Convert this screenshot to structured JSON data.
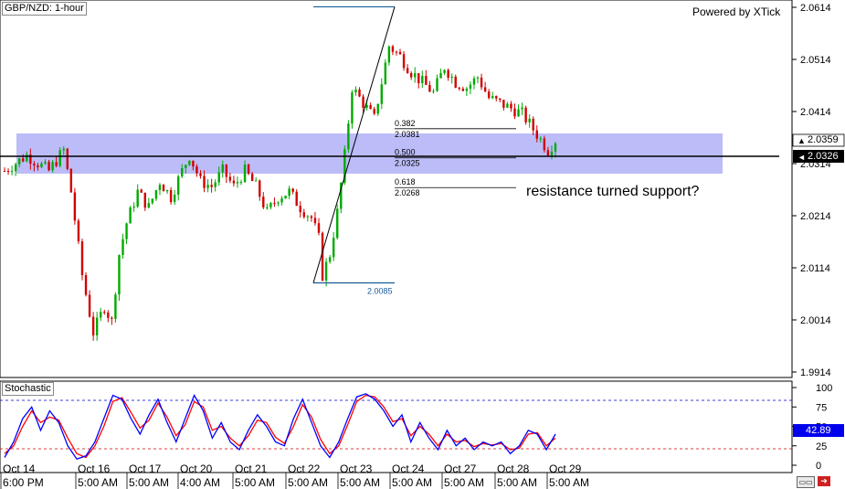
{
  "symbol_label": "GBP/NZD: 1-hour",
  "branding": "Powered by XTick",
  "annotation": "resistance turned support?",
  "indicator_label": "Stochastic",
  "icons": [
    "scroll-icon",
    "go-to-end-icon"
  ],
  "colors": {
    "bull_candle": "#00aa00",
    "bear_candle": "#d10000",
    "zone": "#8f8ff5",
    "stoch_k": "#0000ff",
    "stoch_d": "#ff0000",
    "level_80": "#0000cc",
    "level_20": "#cc0000"
  },
  "chart_data": [
    {
      "type": "candlestick",
      "title": "GBP/NZD: 1-hour",
      "y_ticks": [
        "2.0614",
        "2.0514",
        "2.0414",
        "2.0314",
        "2.0214",
        "2.0114",
        "2.0014",
        "1.9914"
      ],
      "x_ticks": [
        {
          "day": "Oct 14",
          "time": "6:00 PM"
        },
        {
          "day": "Oct 16",
          "time": "5:00 AM"
        },
        {
          "day": "Oct 17",
          "time": "5:00 AM"
        },
        {
          "day": "Oct 20",
          "time": "4:00 AM"
        },
        {
          "day": "Oct 21",
          "time": "5:00 AM"
        },
        {
          "day": "Oct 22",
          "time": "5:00 AM"
        },
        {
          "day": "Oct 23",
          "time": "5:00 AM"
        },
        {
          "day": "Oct 24",
          "time": "5:00 AM"
        },
        {
          "day": "Oct 27",
          "time": "5:00 AM"
        },
        {
          "day": "Oct 28",
          "time": "5:00 AM"
        },
        {
          "day": "Oct 29",
          "time": "5:00 AM"
        }
      ],
      "ylim": [
        1.9894,
        2.064
      ],
      "current_price": "2.0359",
      "horizontal_line_price": "2.0326",
      "resistance_zone": [
        2.031,
        2.0352
      ],
      "fibonacci": {
        "swing_high": 2.0615,
        "swing_low": "2.0085",
        "levels": [
          {
            "ratio": "0.382",
            "price": "2.0381"
          },
          {
            "ratio": "0.500",
            "price": "2.0325"
          },
          {
            "ratio": "0.618",
            "price": "2.0268"
          }
        ]
      },
      "close_path": [
        [
          0,
          2.03
        ],
        [
          6,
          2.033
        ],
        [
          12,
          2.03
        ],
        [
          16,
          2.034
        ],
        [
          18,
          2.026
        ],
        [
          21,
          2.01
        ],
        [
          24,
          1.999
        ],
        [
          27,
          2.004
        ],
        [
          29,
          2.001
        ],
        [
          31,
          2.014
        ],
        [
          33,
          2.02
        ],
        [
          36,
          2.026
        ],
        [
          39,
          2.023
        ],
        [
          42,
          2.028
        ],
        [
          45,
          2.025
        ],
        [
          48,
          2.03
        ],
        [
          50,
          2.033
        ],
        [
          53,
          2.028
        ],
        [
          56,
          2.027
        ],
        [
          59,
          2.03
        ],
        [
          62,
          2.027
        ],
        [
          65,
          2.03
        ],
        [
          68,
          2.027
        ],
        [
          71,
          2.022
        ],
        [
          74,
          2.025
        ],
        [
          77,
          2.026
        ],
        [
          80,
          2.023
        ],
        [
          83,
          2.021
        ],
        [
          85,
          2.017
        ],
        [
          86,
          2.01
        ],
        [
          88,
          2.014
        ],
        [
          90,
          2.022
        ],
        [
          92,
          2.033
        ],
        [
          94,
          2.046
        ],
        [
          96,
          2.044
        ],
        [
          98,
          2.042
        ],
        [
          100,
          2.04
        ],
        [
          102,
          2.047
        ],
        [
          104,
          2.054
        ],
        [
          107,
          2.052
        ],
        [
          110,
          2.049
        ],
        [
          113,
          2.047
        ],
        [
          116,
          2.045
        ],
        [
          119,
          2.05
        ],
        [
          122,
          2.047
        ],
        [
          125,
          2.046
        ],
        [
          128,
          2.048
        ],
        [
          131,
          2.044
        ],
        [
          134,
          2.043
        ],
        [
          137,
          2.042
        ],
        [
          140,
          2.041
        ],
        [
          143,
          2.038
        ],
        [
          145,
          2.036
        ],
        [
          147,
          2.034
        ],
        [
          149,
          2.0359
        ]
      ],
      "candle_count": 150
    },
    {
      "type": "line",
      "title": "Stochastic",
      "y_ticks": [
        "100",
        "75",
        "50",
        "25",
        "0"
      ],
      "levels": [
        80,
        20
      ],
      "current_value": "42.89",
      "ylim": [
        0,
        100
      ],
      "series": [
        {
          "key": "k",
          "values": [
            10,
            30,
            60,
            75,
            45,
            70,
            55,
            25,
            8,
            12,
            30,
            60,
            90,
            85,
            60,
            40,
            65,
            85,
            55,
            30,
            60,
            90,
            70,
            35,
            55,
            30,
            20,
            45,
            65,
            50,
            30,
            25,
            60,
            85,
            55,
            25,
            10,
            30,
            60,
            88,
            92,
            85,
            70,
            50,
            65,
            30,
            55,
            35,
            20,
            45,
            25,
            35,
            20,
            30,
            25,
            30,
            15,
            25,
            45,
            40,
            20,
            40
          ]
        },
        {
          "key": "d",
          "values": [
            15,
            25,
            50,
            70,
            55,
            62,
            58,
            35,
            15,
            10,
            25,
            50,
            82,
            87,
            68,
            48,
            58,
            80,
            62,
            38,
            52,
            82,
            75,
            45,
            50,
            35,
            25,
            38,
            58,
            55,
            36,
            28,
            50,
            78,
            62,
            33,
            15,
            25,
            52,
            82,
            90,
            88,
            75,
            56,
            60,
            38,
            50,
            40,
            25,
            40,
            30,
            32,
            24,
            28,
            26,
            28,
            20,
            22,
            40,
            42,
            25,
            35
          ]
        }
      ]
    }
  ]
}
